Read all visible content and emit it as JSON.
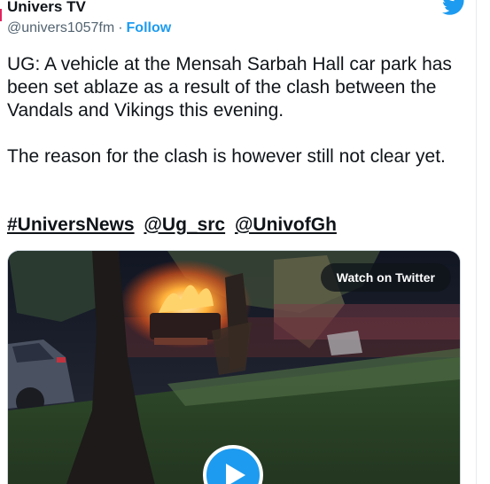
{
  "tweet": {
    "display_name": "Univers TV",
    "handle": "@univers1057fm",
    "separator": "·",
    "follow_label": "Follow",
    "paragraphs": [
      "UG: A vehicle at the Mensah Sarbah Hall car park has been set ablaze as a result of the clash between the Vandals and Vikings this evening.",
      "The reason for the clash is however still not clear yet."
    ],
    "tags": [
      "#UniversNews",
      "@Ug_src",
      "@UnivofGh"
    ],
    "media": {
      "watch_label": "Watch on Twitter"
    }
  },
  "colors": {
    "accent": "#1d9bf0",
    "text": "#0f1419",
    "secondary": "#536471"
  },
  "icons": {
    "logo": "twitter-bird-icon",
    "play": "play-icon"
  }
}
